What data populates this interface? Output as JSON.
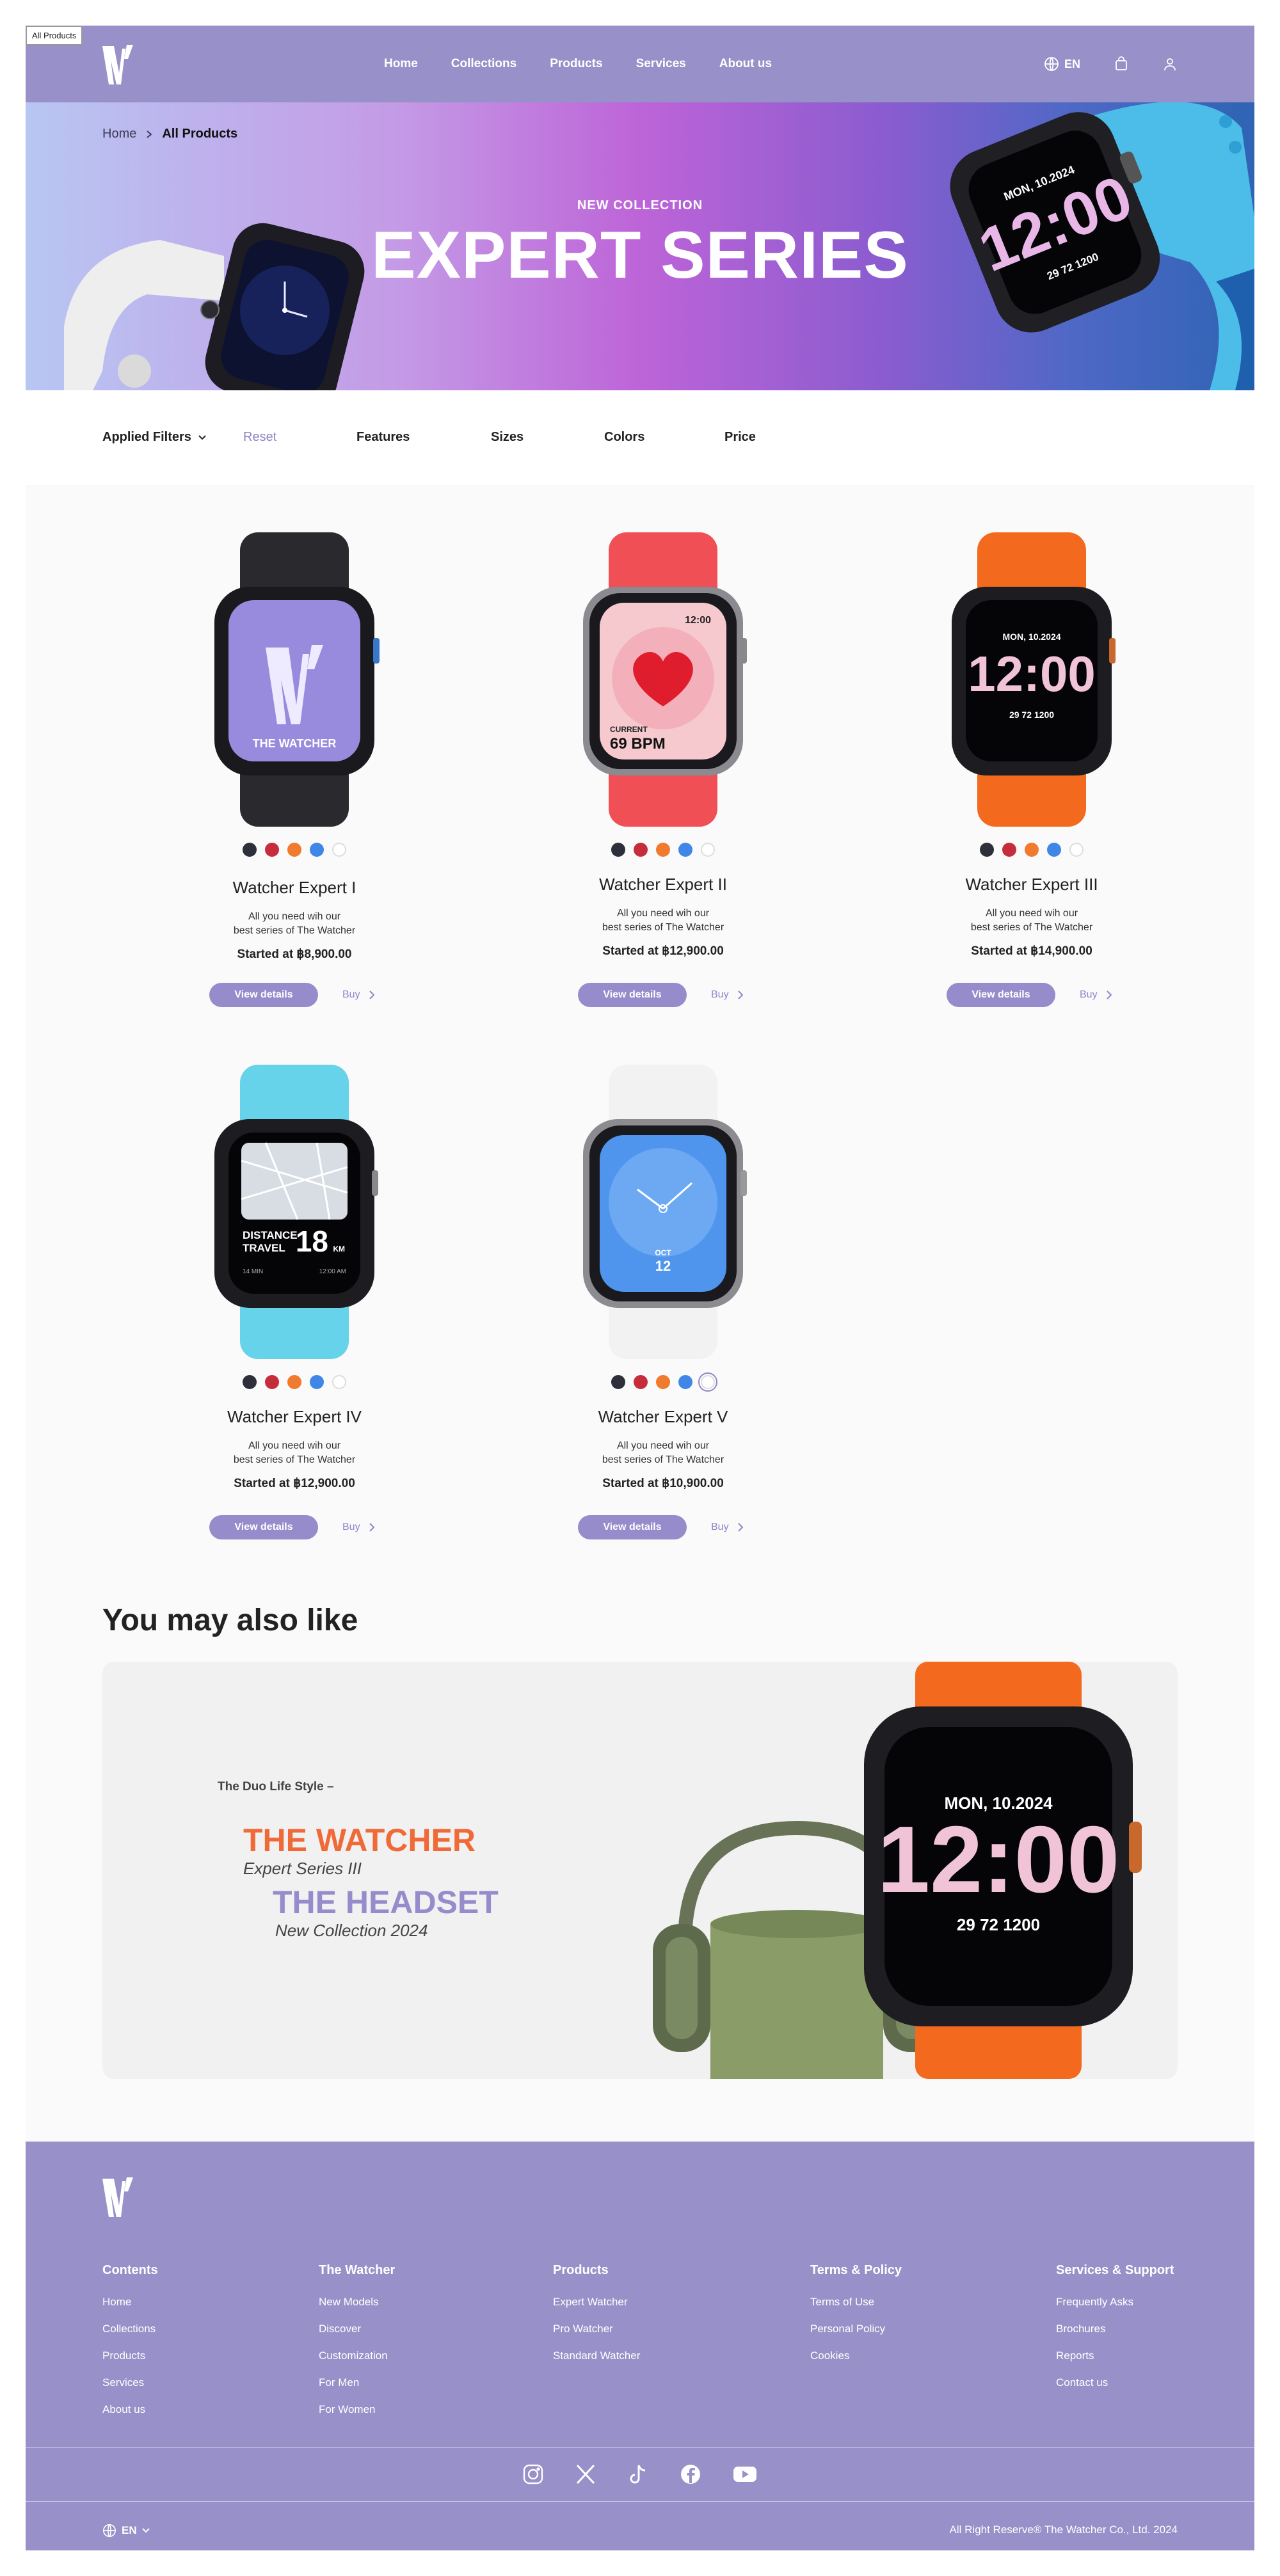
{
  "tab_label": "All Products",
  "header": {
    "nav": [
      "Home",
      "Collections",
      "Products",
      "Services",
      "About us"
    ],
    "lang": "EN"
  },
  "hero": {
    "breadcrumb_home": "Home",
    "breadcrumb_current": "All Products",
    "subtitle": "NEW COLLECTION",
    "title": "EXPERT SERIES",
    "watch_date": "MON, 10.2024",
    "watch_time": "12:00",
    "watch_stats": "29  72  1200"
  },
  "filters": {
    "applied": "Applied Filters",
    "reset": "Reset",
    "features": "Features",
    "sizes": "Sizes",
    "colors": "Colors",
    "price": "Price"
  },
  "colors": {
    "accent": "#968ccb",
    "swatches": [
      "#2d2f3a",
      "#c62d3b",
      "#f07a2e",
      "#3f87e6",
      "#ffffff"
    ]
  },
  "products": [
    {
      "name": "Watcher Expert I",
      "desc1": "All you need wih our",
      "desc2": "best series of The Watcher",
      "price": "Started at ฿8,900.00",
      "view": "View details",
      "buy": "Buy",
      "screen": "THE WATCHER"
    },
    {
      "name": "Watcher Expert II",
      "desc1": "All you need wih our",
      "desc2": "best series of The Watcher",
      "price": "Started at ฿12,900.00",
      "view": "View details",
      "buy": "Buy",
      "screen_time": "12:00",
      "screen_label": "CURRENT",
      "screen_value": "69 BPM"
    },
    {
      "name": "Watcher Expert III",
      "desc1": "All you need wih our",
      "desc2": "best series of The Watcher",
      "price": "Started at ฿14,900.00",
      "view": "View details",
      "buy": "Buy",
      "screen_date": "MON, 10.2024",
      "screen_time": "12:00",
      "screen_stats": "29  72  1200"
    },
    {
      "name": "Watcher Expert IV",
      "desc1": "All you need wih our",
      "desc2": "best series of The Watcher",
      "price": "Started at ฿12,900.00",
      "view": "View details",
      "buy": "Buy",
      "screen_label1": "DISTANCE",
      "screen_label2": "TRAVEL",
      "screen_value": "18",
      "screen_unit": "KM",
      "screen_foot_left": "14 MIN",
      "screen_foot_right": "12:00 AM"
    },
    {
      "name": "Watcher Expert V",
      "desc1": "All you need wih our",
      "desc2": "best series of The Watcher",
      "price": "Started at ฿10,900.00",
      "view": "View details",
      "buy": "Buy",
      "screen_month": "OCT",
      "screen_day": "12"
    }
  ],
  "recommend": {
    "title": "You may also like",
    "tagline": "The Duo Life Style –",
    "t1": "THE WATCHER",
    "s1": "Expert Series III",
    "t2": "THE HEADSET",
    "s2": "New Collection 2024",
    "watch_date": "MON, 10.2024",
    "watch_time": "12:00",
    "watch_stats": "29   72   1200"
  },
  "footer": {
    "columns": [
      {
        "title": "Contents",
        "links": [
          "Home",
          "Collections",
          "Products",
          "Services",
          "About us"
        ]
      },
      {
        "title": "The Watcher",
        "links": [
          "New Models",
          "Discover",
          "Customization",
          "For Men",
          "For Women"
        ]
      },
      {
        "title": "Products",
        "links": [
          "Expert Watcher",
          "Pro Watcher",
          "Standard  Watcher"
        ]
      },
      {
        "title": "Terms & Policy",
        "links": [
          "Terms of Use",
          "Personal Policy",
          "Cookies"
        ]
      },
      {
        "title": "Services & Support",
        "links": [
          "Frequently Asks",
          "Brochures",
          "Reports",
          "Contact us"
        ]
      }
    ],
    "lang": "EN",
    "copyright": "All Right Reserve® The Watcher Co., Ltd. 2024",
    "socials": [
      "instagram-icon",
      "x-icon",
      "tiktok-icon",
      "facebook-icon",
      "youtube-icon"
    ]
  }
}
